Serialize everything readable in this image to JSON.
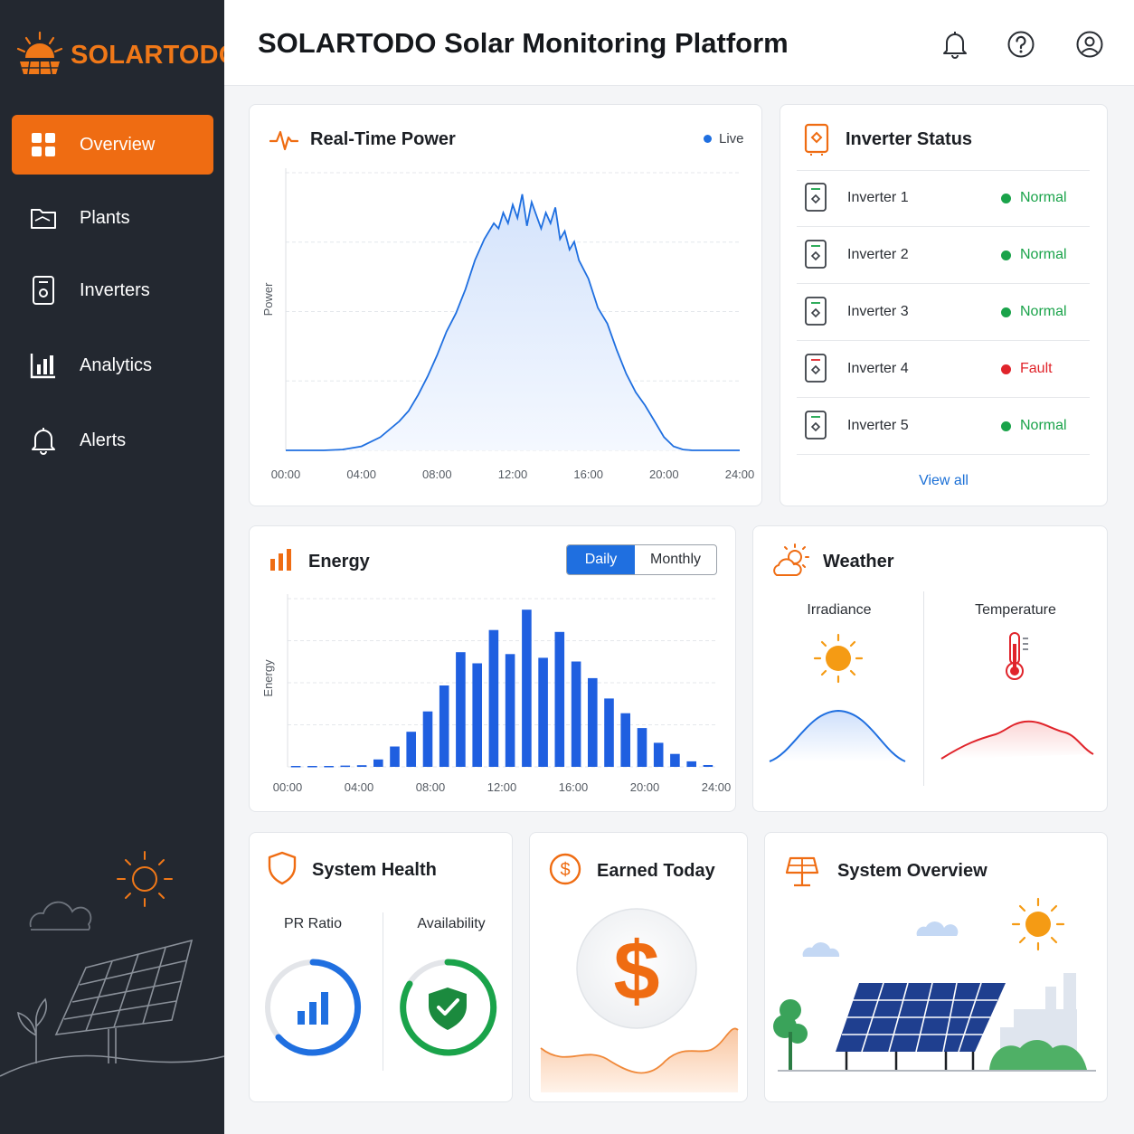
{
  "app": {
    "logo_text": "SOLARTODO",
    "page_title": "SOLARTODO Solar Monitoring Platform"
  },
  "sidebar": {
    "items": [
      {
        "label": "Overview",
        "icon": "grid-icon",
        "active": true
      },
      {
        "label": "Plants",
        "icon": "folder-icon",
        "active": false
      },
      {
        "label": "Inverters",
        "icon": "inverter-icon",
        "active": false
      },
      {
        "label": "Analytics",
        "icon": "bar-chart-icon",
        "active": false
      },
      {
        "label": "Alerts",
        "icon": "bell-icon",
        "active": false
      }
    ]
  },
  "header": {
    "icons": [
      "bell-icon",
      "help-icon",
      "user-icon"
    ]
  },
  "realtime": {
    "title": "Real-Time Power",
    "live_label": "Live",
    "ylabel": "Power"
  },
  "inverter_status": {
    "title": "Inverter Status",
    "items": [
      {
        "name": "Inverter 1",
        "status": "Normal",
        "color": "#1aa34a"
      },
      {
        "name": "Inverter 2",
        "status": "Normal",
        "color": "#1aa34a"
      },
      {
        "name": "Inverter 3",
        "status": "Normal",
        "color": "#1aa34a"
      },
      {
        "name": "Inverter 4",
        "status": "Fault",
        "color": "#e0242b"
      },
      {
        "name": "Inverter 5",
        "status": "Normal",
        "color": "#1aa34a"
      }
    ],
    "view_all": "View all"
  },
  "energy": {
    "title": "Energy",
    "toggle": [
      "Daily",
      "Monthly"
    ],
    "active_toggle": "Daily",
    "ylabel": "Energy"
  },
  "weather": {
    "title": "Weather",
    "irradiance_label": "Irradiance",
    "temperature_label": "Temperature"
  },
  "system_health": {
    "title": "System Health",
    "pr_label": "PR Ratio",
    "availability_label": "Availability"
  },
  "earned": {
    "title": "Earned Today",
    "symbol": "$"
  },
  "overview": {
    "title": "System Overview"
  },
  "colors": {
    "accent": "#ef6c12",
    "blue": "#1f6fe0",
    "sidebar": "#232830",
    "green": "#1aa34a",
    "red": "#e0242b"
  },
  "chart_data": [
    {
      "type": "area",
      "title": "Real-Time Power",
      "ylabel": "Power",
      "x_ticks": [
        "00:00",
        "04:00",
        "08:00",
        "12:00",
        "16:00",
        "20:00",
        "24:00"
      ],
      "x_hours": [
        0,
        1,
        2,
        3,
        4,
        5,
        6,
        6.5,
        7,
        7.5,
        8,
        8.5,
        9,
        9.5,
        10,
        10.5,
        11,
        11.25,
        11.5,
        11.75,
        12,
        12.25,
        12.5,
        12.75,
        13,
        13.25,
        13.5,
        13.75,
        14,
        14.25,
        14.5,
        14.75,
        15,
        15.25,
        15.5,
        16,
        16.5,
        17,
        17.5,
        18,
        18.5,
        19,
        19.5,
        20,
        20.5,
        21,
        21.5,
        22,
        23,
        24
      ],
      "values": [
        0,
        0,
        0,
        0.3,
        1.5,
        5,
        11,
        15,
        21,
        28,
        36,
        45,
        52,
        61,
        72,
        80,
        86,
        84,
        90,
        86,
        93,
        88,
        97,
        85,
        94,
        89,
        84,
        90,
        86,
        92,
        80,
        83,
        76,
        79,
        72,
        65,
        54,
        48,
        38,
        29,
        22,
        17,
        11,
        5,
        1.5,
        0.3,
        0,
        0,
        0,
        0
      ],
      "ylim": [
        0,
        100
      ]
    },
    {
      "type": "bar",
      "title": "Energy",
      "ylabel": "Energy",
      "x_ticks": [
        "00:00",
        "04:00",
        "08:00",
        "12:00",
        "16:00",
        "20:00",
        "24:00"
      ],
      "categories": [
        "00",
        "01",
        "02",
        "03",
        "04",
        "05",
        "06",
        "07",
        "08",
        "09",
        "10",
        "11",
        "12",
        "13",
        "14",
        "15",
        "16",
        "17",
        "18",
        "19",
        "20",
        "21",
        "22",
        "23",
        "24",
        "25"
      ],
      "values": [
        0.5,
        0.5,
        0.5,
        0.7,
        0.9,
        4,
        11,
        19,
        30,
        44,
        62,
        56,
        74,
        61,
        85,
        59,
        73,
        57,
        48,
        37,
        29,
        21,
        13,
        7,
        3,
        1
      ],
      "ylim": [
        0,
        90
      ]
    }
  ]
}
